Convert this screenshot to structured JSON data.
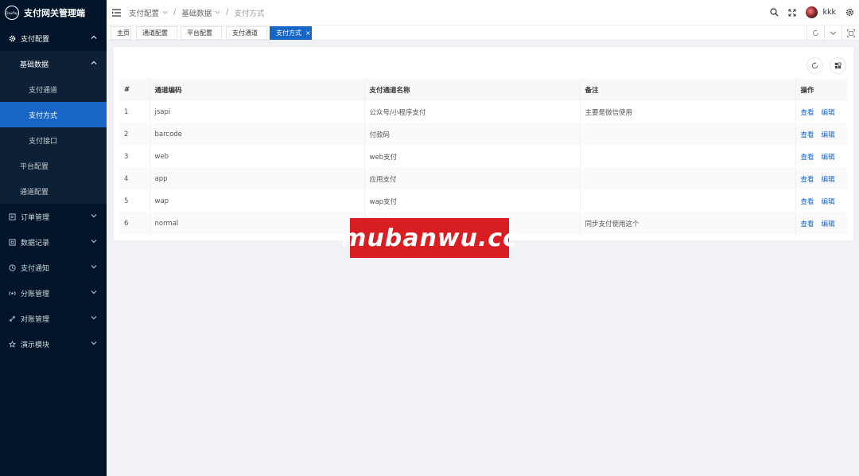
{
  "app": {
    "logo_text": "DaxPay",
    "title": "支付网关管理端"
  },
  "sidebar": {
    "items": [
      {
        "label": "支付配置",
        "icon": "gear-icon"
      },
      {
        "label": "基础数据"
      },
      {
        "label": "支付通道"
      },
      {
        "label": "支付方式"
      },
      {
        "label": "支付接口"
      },
      {
        "label": "平台配置"
      },
      {
        "label": "通道配置"
      },
      {
        "label": "订单管理",
        "icon": "order-icon"
      },
      {
        "label": "数据记录",
        "icon": "record-icon"
      },
      {
        "label": "支付通知",
        "icon": "clock-icon"
      },
      {
        "label": "分账管理",
        "icon": "split-icon"
      },
      {
        "label": "对账管理",
        "icon": "reconcile-icon"
      },
      {
        "label": "演示模块",
        "icon": "demo-icon"
      }
    ]
  },
  "header": {
    "breadcrumb": [
      "支付配置",
      "基础数据",
      "支付方式"
    ],
    "username": "kkk"
  },
  "tabs": [
    {
      "label": "主页"
    },
    {
      "label": "通道配置"
    },
    {
      "label": "平台配置"
    },
    {
      "label": "支付通道"
    },
    {
      "label": "支付方式",
      "close": "×"
    }
  ],
  "table": {
    "columns": [
      "#",
      "通道编码",
      "支付通道名称",
      "备注",
      "操作"
    ],
    "rows": [
      {
        "no": "1",
        "code": "jsapi",
        "name": "公众号/小程序支付",
        "remark": "主要是微信使用"
      },
      {
        "no": "2",
        "code": "barcode",
        "name": "付款码",
        "remark": ""
      },
      {
        "no": "3",
        "code": "web",
        "name": "web支付",
        "remark": ""
      },
      {
        "no": "4",
        "code": "app",
        "name": "应用支付",
        "remark": ""
      },
      {
        "no": "5",
        "code": "wap",
        "name": "wap支付",
        "remark": ""
      },
      {
        "no": "6",
        "code": "normal",
        "name": "",
        "remark": "同步支付使用这个"
      }
    ],
    "actions": {
      "view": "查看",
      "edit": "编辑"
    }
  },
  "watermark": "mubanwu.cc",
  "colors": {
    "sidebar_bg": "#001529",
    "accent": "#1765c4",
    "watermark_bg": "#d81e22"
  }
}
